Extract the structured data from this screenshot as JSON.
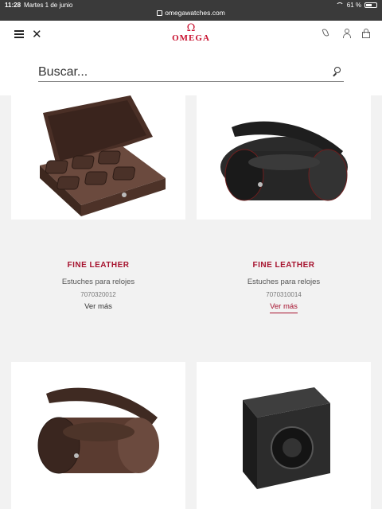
{
  "status_bar": {
    "time": "11:28",
    "date": "Martes 1 de junio",
    "url": "omegawatches.com",
    "battery": "61 %",
    "battery_level": 0.61
  },
  "header": {
    "logo_symbol": "Ω",
    "logo_text": "OMEGA",
    "icons": [
      "menu-icon",
      "close-icon",
      "phone-icon",
      "user-icon",
      "bag-icon"
    ]
  },
  "search": {
    "placeholder": "Buscar..."
  },
  "products": [
    {
      "collection": "FINE LEATHER",
      "type": "Estuches para relojes",
      "reference": "7070320012",
      "link": "Ver más"
    },
    {
      "collection": "FINE LEATHER",
      "type": "Estuches para relojes",
      "reference": "7070310014",
      "link": "Ver más"
    }
  ],
  "colors": {
    "brand_red": "#c8102e",
    "collection_red": "#a6122e",
    "status_bar_bg": "#3a3a3a",
    "page_bg": "#f2f2f2"
  }
}
